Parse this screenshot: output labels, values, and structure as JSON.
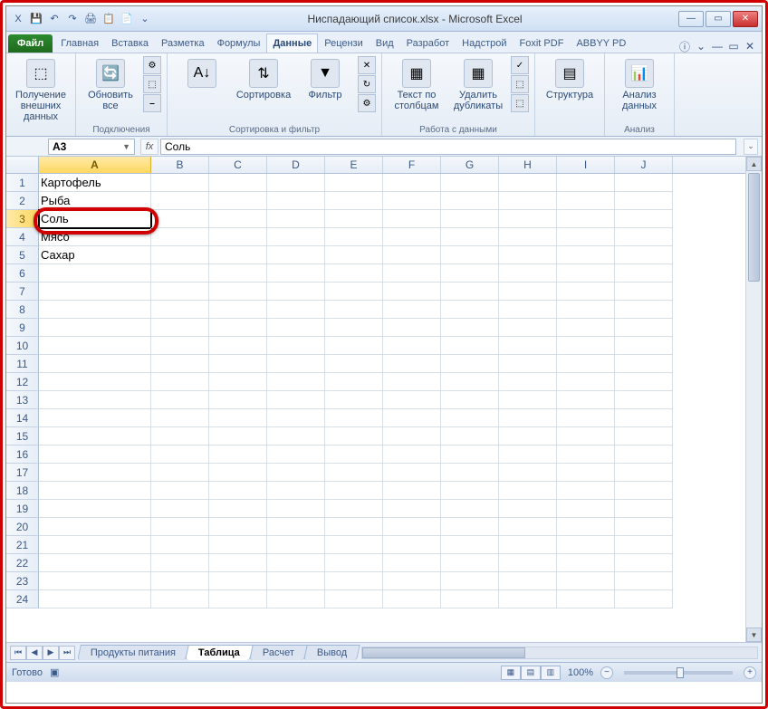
{
  "window": {
    "title": "Ниспадающий список.xlsx - Microsoft Excel"
  },
  "qat": [
    "X",
    "💾",
    "↶",
    "↷",
    "🖨",
    "📋",
    "📄",
    "⌄"
  ],
  "tabs": {
    "file": "Файл",
    "items": [
      "Главная",
      "Вставка",
      "Разметка",
      "Формулы",
      "Данные",
      "Рецензи",
      "Вид",
      "Разработ",
      "Надстрой",
      "Foxit PDF",
      "ABBYY PD"
    ],
    "active": "Данные"
  },
  "ribbon": {
    "groups": [
      {
        "big": [
          {
            "icon": "⬚",
            "label": "Получение\nвнешних данных"
          }
        ],
        "label": ""
      },
      {
        "big": [
          {
            "icon": "🔄",
            "label": "Обновить\nвсе"
          }
        ],
        "small": [
          "⚙",
          "⬚",
          "⎯"
        ],
        "label": "Подключения"
      },
      {
        "big": [
          {
            "icon": "A↓",
            "label": ""
          },
          {
            "icon": "⇅",
            "label": "Сортировка"
          },
          {
            "icon": "▼",
            "label": "Фильтр"
          }
        ],
        "small": [
          "✕",
          "↻",
          "⚙"
        ],
        "label": "Сортировка и фильтр"
      },
      {
        "big": [
          {
            "icon": "▦",
            "label": "Текст по\nстолбцам"
          },
          {
            "icon": "▦",
            "label": "Удалить\nдубликаты"
          }
        ],
        "small": [
          "✓",
          "⬚",
          "⬚"
        ],
        "label": "Работа с данными"
      },
      {
        "big": [
          {
            "icon": "▤",
            "label": "Структура"
          }
        ],
        "label": ""
      },
      {
        "big": [
          {
            "icon": "📊",
            "label": "Анализ данных"
          }
        ],
        "label": "Анализ"
      }
    ]
  },
  "formulabar": {
    "namebox": "A3",
    "fx": "fx",
    "formula": "Соль"
  },
  "columns": [
    "A",
    "B",
    "C",
    "D",
    "E",
    "F",
    "G",
    "H",
    "I",
    "J"
  ],
  "rows": [
    {
      "n": 1,
      "A": "Картофель"
    },
    {
      "n": 2,
      "A": "Рыба"
    },
    {
      "n": 3,
      "A": "Соль",
      "selected": true
    },
    {
      "n": 4,
      "A": "Мясо"
    },
    {
      "n": 5,
      "A": "Сахар"
    },
    {
      "n": 6,
      "A": ""
    },
    {
      "n": 7,
      "A": ""
    },
    {
      "n": 8,
      "A": ""
    },
    {
      "n": 9,
      "A": ""
    },
    {
      "n": 10,
      "A": ""
    },
    {
      "n": 11,
      "A": ""
    },
    {
      "n": 12,
      "A": ""
    },
    {
      "n": 13,
      "A": ""
    },
    {
      "n": 14,
      "A": ""
    },
    {
      "n": 15,
      "A": ""
    },
    {
      "n": 16,
      "A": ""
    },
    {
      "n": 17,
      "A": ""
    },
    {
      "n": 18,
      "A": ""
    },
    {
      "n": 19,
      "A": ""
    },
    {
      "n": 20,
      "A": ""
    },
    {
      "n": 21,
      "A": ""
    },
    {
      "n": 22,
      "A": ""
    },
    {
      "n": 23,
      "A": ""
    },
    {
      "n": 24,
      "A": ""
    }
  ],
  "sheets": {
    "items": [
      "Продукты питания",
      "Таблица",
      "Расчет",
      "Вывод"
    ],
    "active": "Таблица"
  },
  "status": {
    "ready": "Готово",
    "zoom": "100%"
  }
}
